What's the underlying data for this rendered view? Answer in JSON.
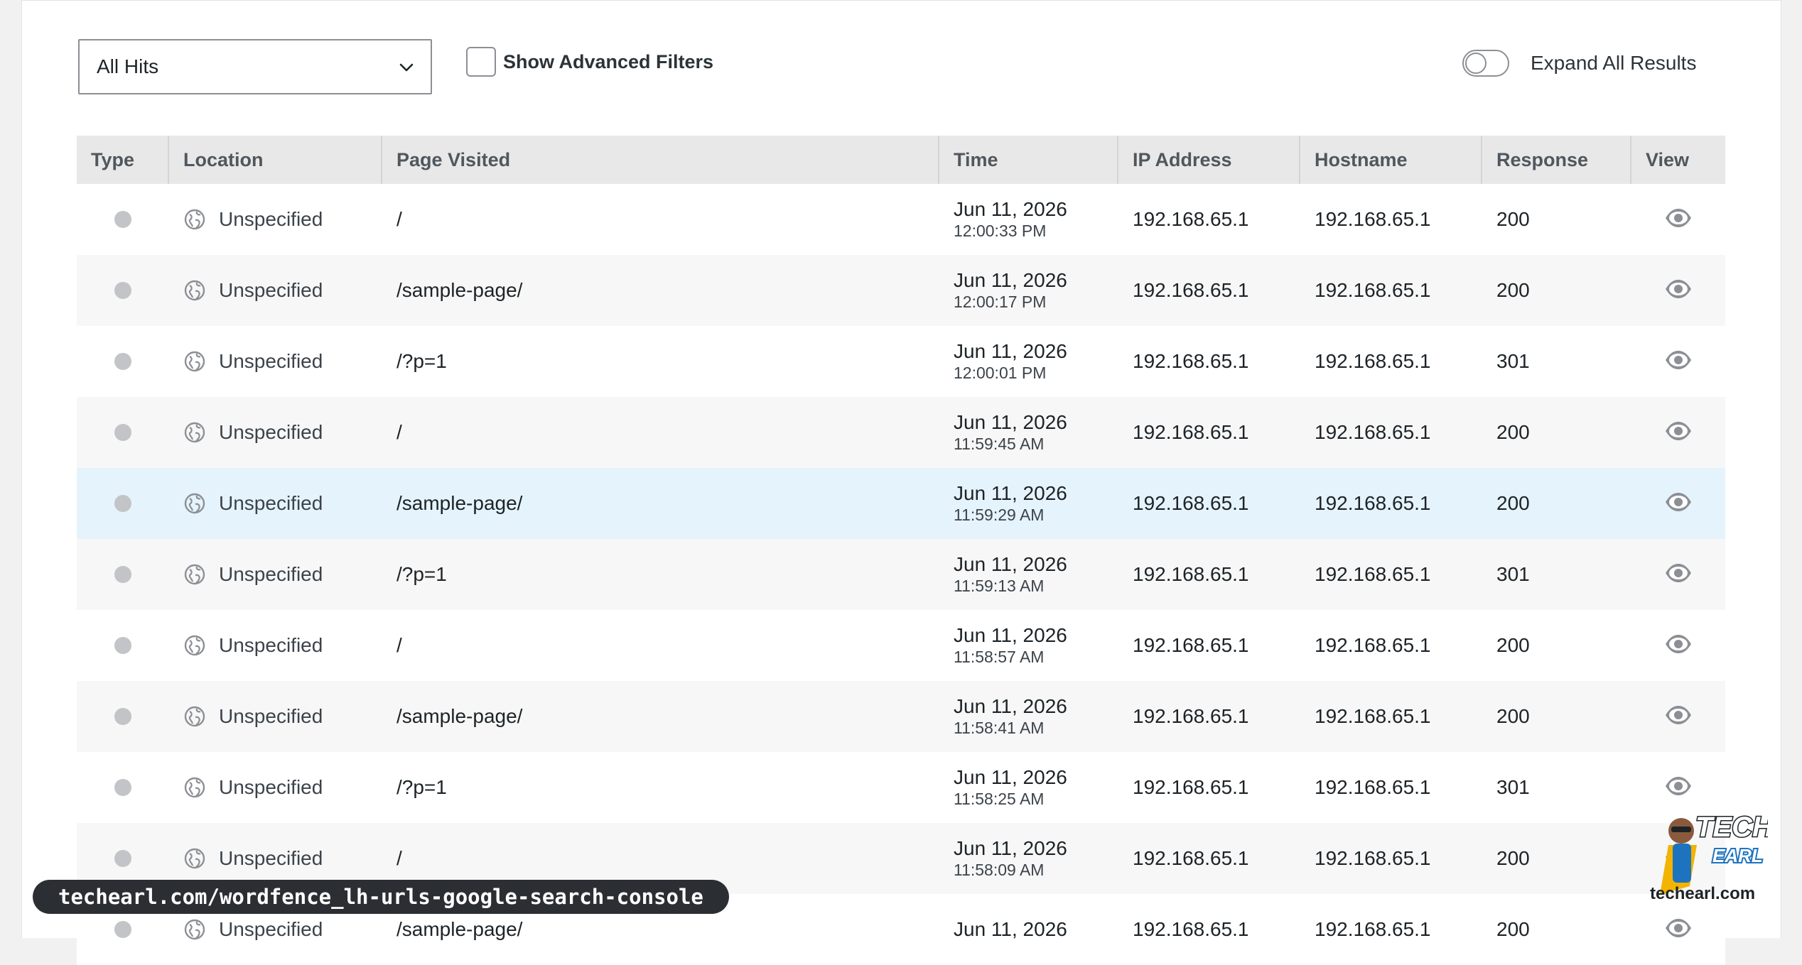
{
  "toolbar": {
    "filter_select": "All Hits",
    "advanced_filters_label": "Show Advanced Filters",
    "expand_label": "Expand All Results"
  },
  "table": {
    "headers": [
      "Type",
      "Location",
      "Page Visited",
      "Time",
      "IP Address",
      "Hostname",
      "Response",
      "View"
    ],
    "rows": [
      {
        "location": "Unspecified",
        "page": "/",
        "date": "Jun 11, 2026",
        "time": "12:00:33 PM",
        "ip": "192.168.65.1",
        "host": "192.168.65.1",
        "response": "200"
      },
      {
        "location": "Unspecified",
        "page": "/sample-page/",
        "date": "Jun 11, 2026",
        "time": "12:00:17 PM",
        "ip": "192.168.65.1",
        "host": "192.168.65.1",
        "response": "200"
      },
      {
        "location": "Unspecified",
        "page": "/?p=1",
        "date": "Jun 11, 2026",
        "time": "12:00:01 PM",
        "ip": "192.168.65.1",
        "host": "192.168.65.1",
        "response": "301"
      },
      {
        "location": "Unspecified",
        "page": "/",
        "date": "Jun 11, 2026",
        "time": "11:59:45 AM",
        "ip": "192.168.65.1",
        "host": "192.168.65.1",
        "response": "200"
      },
      {
        "location": "Unspecified",
        "page": "/sample-page/",
        "date": "Jun 11, 2026",
        "time": "11:59:29 AM",
        "ip": "192.168.65.1",
        "host": "192.168.65.1",
        "response": "200"
      },
      {
        "location": "Unspecified",
        "page": "/?p=1",
        "date": "Jun 11, 2026",
        "time": "11:59:13 AM",
        "ip": "192.168.65.1",
        "host": "192.168.65.1",
        "response": "301"
      },
      {
        "location": "Unspecified",
        "page": "/",
        "date": "Jun 11, 2026",
        "time": "11:58:57 AM",
        "ip": "192.168.65.1",
        "host": "192.168.65.1",
        "response": "200"
      },
      {
        "location": "Unspecified",
        "page": "/sample-page/",
        "date": "Jun 11, 2026",
        "time": "11:58:41 AM",
        "ip": "192.168.65.1",
        "host": "192.168.65.1",
        "response": "200"
      },
      {
        "location": "Unspecified",
        "page": "/?p=1",
        "date": "Jun 11, 2026",
        "time": "11:58:25 AM",
        "ip": "192.168.65.1",
        "host": "192.168.65.1",
        "response": "301"
      },
      {
        "location": "Unspecified",
        "page": "/",
        "date": "Jun 11, 2026",
        "time": "11:58:09 AM",
        "ip": "192.168.65.1",
        "host": "192.168.65.1",
        "response": "200"
      },
      {
        "location": "Unspecified",
        "page": "/sample-page/",
        "date": "Jun 11, 2026",
        "time": "",
        "ip": "192.168.65.1",
        "host": "192.168.65.1",
        "response": "200"
      }
    ]
  },
  "watermark": {
    "url": "techearl.com/wordfence_lh-urls-google-search-console",
    "brand": "techearl.com",
    "logo_text": "TECH EARL"
  },
  "icons": {
    "dropdown": "chevron-down-icon",
    "type": "status-dot-icon",
    "location": "globe-icon",
    "view": "eye-icon"
  },
  "colors": {
    "highlight_row": "#e5f3fc",
    "header_bg": "#e8e8e8",
    "pill_bg": "#2b2f33"
  }
}
